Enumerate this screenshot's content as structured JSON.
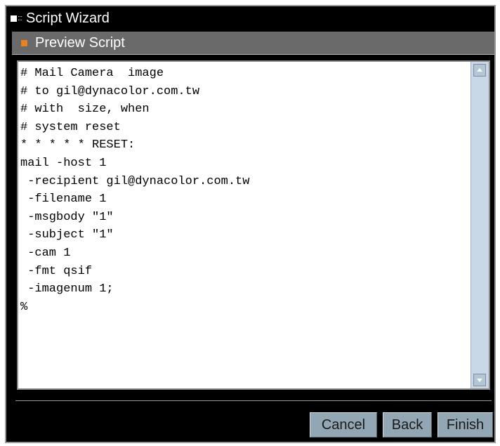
{
  "window": {
    "title": "Script Wizard"
  },
  "section": {
    "title": "Preview Script"
  },
  "script": {
    "content": "# Mail Camera  image\n# to gil@dynacolor.com.tw\n# with  size, when\n# system reset\n* * * * * RESET:\nmail -host 1\n -recipient gil@dynacolor.com.tw\n -filename 1\n -msgbody \"1\"\n -subject \"1\"\n -cam 1\n -fmt qsif\n -imagenum 1;\n%"
  },
  "buttons": {
    "cancel": "Cancel",
    "back": "Back",
    "finish": "Finish"
  },
  "colors": {
    "accent": "#e8821e",
    "button": "#93a6b3",
    "scrollbar": "#c8d8e6"
  }
}
